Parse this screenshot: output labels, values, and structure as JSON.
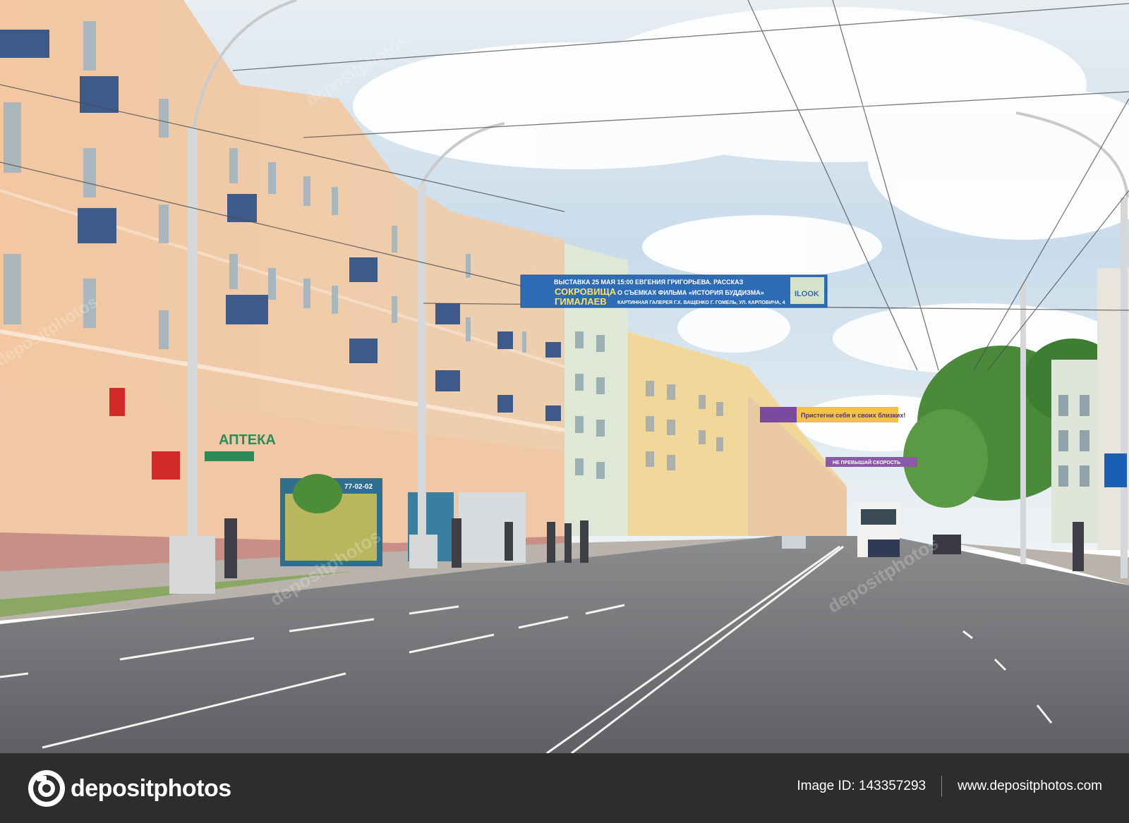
{
  "photo": {
    "banners": {
      "main_line1": "ВЫСТАВКА 25 МАЯ 15:00 ЕВГЕНИЯ ГРИГОРЬЕВА. РАССКАЗ",
      "main_big1": "СОКРОВИЩА",
      "main_big2": "ГИМАЛАЕВ",
      "main_line2": "О СЪЕМКАХ ФИЛЬМА «ИСТОРИЯ БУДДИЗМА»",
      "main_line3": "КАРТИННАЯ ГАЛЕРЕЯ Г.Х. ВАЩЕНКО Г. ГОМЕЛЬ, УЛ. КАРПОВИЧА, 4",
      "main_sponsor": "ILOOK",
      "secondary": "Пристегни себя и своих близких!",
      "third": "НЕ ПРЕВЫШАЙ СКОРОСТЬ"
    },
    "signs": {
      "pharmacy": "АПТЕКА",
      "kiosk_phone": "77-02-02"
    },
    "watermark": "depositphotos"
  },
  "footer": {
    "logo_text": "depositphotos",
    "image_id_label": "Image ID: 143357293",
    "site_url": "www.depositphotos.com"
  }
}
